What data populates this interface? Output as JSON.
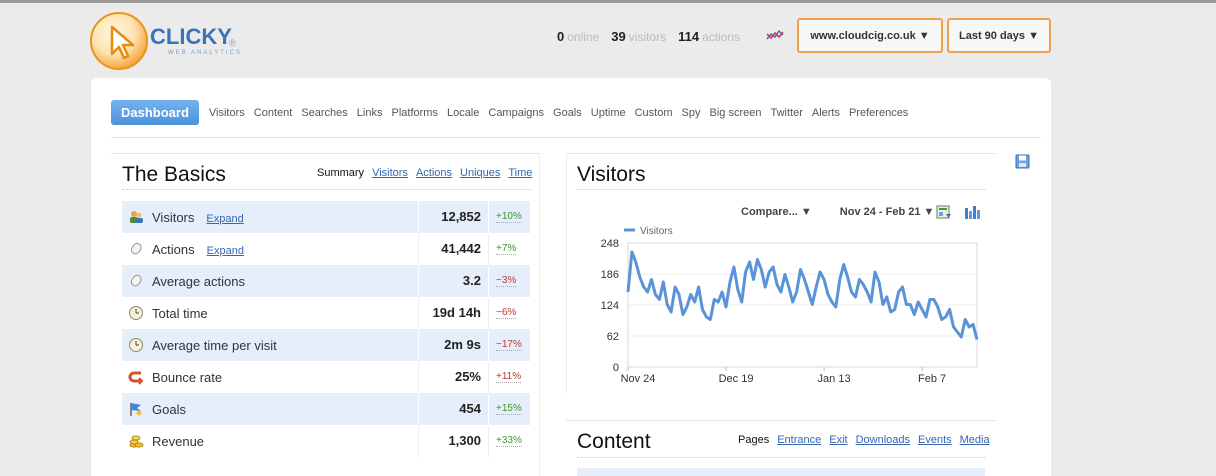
{
  "logo": {
    "word": "CLICKY",
    "sub": "WEB ANALYTICS",
    "reg": "®"
  },
  "header_stats": [
    {
      "value": "0",
      "label": "online"
    },
    {
      "value": "39",
      "label": "visitors"
    },
    {
      "value": "114",
      "label": "actions"
    }
  ],
  "site_select": {
    "label": "www.cloudcig.co.uk ▼"
  },
  "range_select": {
    "label": "Last 90 days ▼"
  },
  "nav": {
    "active": "Dashboard",
    "items": [
      "Visitors",
      "Content",
      "Searches",
      "Links",
      "Platforms",
      "Locale",
      "Campaigns",
      "Goals",
      "Uptime",
      "Custom",
      "Spy",
      "Big screen",
      "Twitter",
      "Alerts",
      "Preferences"
    ]
  },
  "basics": {
    "title": "The Basics",
    "tabs": {
      "current": "Summary",
      "links": [
        "Visitors",
        "Actions",
        "Uniques",
        "Time"
      ]
    },
    "rows": [
      {
        "icon": "visitors-icon",
        "name": "Visitors",
        "expand": "Expand",
        "value": "12,852",
        "change": "+10%",
        "dir": "up"
      },
      {
        "icon": "actions-icon",
        "name": "Actions",
        "expand": "Expand",
        "value": "41,442",
        "change": "+7%",
        "dir": "up"
      },
      {
        "icon": "average-actions-icon",
        "name": "Average actions",
        "expand": "",
        "value": "3.2",
        "change": "−3%",
        "dir": "down"
      },
      {
        "icon": "clock-icon",
        "name": "Total time",
        "expand": "",
        "value": "19d 14h",
        "change": "−6%",
        "dir": "down"
      },
      {
        "icon": "clock-icon",
        "name": "Average time per visit",
        "expand": "",
        "value": "2m 9s",
        "change": "−17%",
        "dir": "down"
      },
      {
        "icon": "bounce-icon",
        "name": "Bounce rate",
        "expand": "",
        "value": "25%",
        "change": "+11%",
        "dir": "down"
      },
      {
        "icon": "goals-flag-icon",
        "name": "Goals",
        "expand": "",
        "value": "454",
        "change": "+15%",
        "dir": "up"
      },
      {
        "icon": "revenue-coins-icon",
        "name": "Revenue",
        "expand": "",
        "value": "1,300",
        "change": "+33%",
        "dir": "up"
      }
    ]
  },
  "visitors_panel": {
    "title": "Visitors",
    "compare_label": "Compare... ▼",
    "range_label": "Nov 24 - Feb 21 ▼"
  },
  "chart_data": {
    "type": "line",
    "legend": "Visitors",
    "line_color": "#5b93d8",
    "ylim": [
      0,
      248
    ],
    "yticks": [
      0,
      62,
      124,
      186,
      248
    ],
    "xtick_labels": [
      "Nov 24",
      "Dec 19",
      "Jan 13",
      "Feb 7"
    ],
    "xtick_index": [
      0,
      25,
      50,
      75
    ],
    "series": [
      {
        "name": "Visitors",
        "values": [
          150,
          230,
          210,
          180,
          160,
          150,
          175,
          145,
          135,
          170,
          125,
          110,
          160,
          145,
          105,
          120,
          145,
          130,
          160,
          115,
          100,
          95,
          135,
          130,
          150,
          120,
          170,
          200,
          155,
          130,
          190,
          210,
          175,
          215,
          195,
          160,
          190,
          200,
          165,
          150,
          185,
          160,
          130,
          150,
          195,
          175,
          150,
          125,
          160,
          190,
          175,
          145,
          130,
          120,
          175,
          205,
          180,
          150,
          140,
          175,
          165,
          150,
          130,
          190,
          170,
          125,
          140,
          110,
          115,
          150,
          160,
          125,
          125,
          105,
          130,
          115,
          100,
          135,
          135,
          120,
          95,
          100,
          115,
          80,
          70,
          60,
          95,
          80,
          85,
          55
        ]
      }
    ]
  },
  "content_panel": {
    "title": "Content",
    "tabs": {
      "current": "Pages",
      "links": [
        "Entrance",
        "Exit",
        "Downloads",
        "Events",
        "Media"
      ]
    }
  }
}
